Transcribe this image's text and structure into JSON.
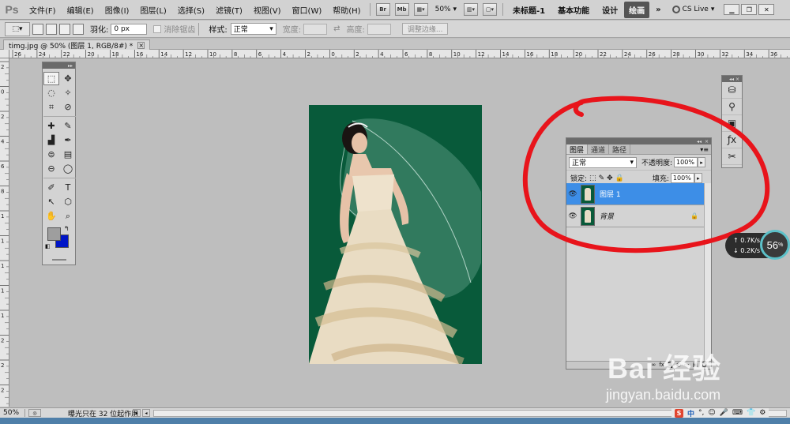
{
  "menubar": {
    "logo": "Ps",
    "items": [
      "文件(F)",
      "编辑(E)",
      "图像(I)",
      "图层(L)",
      "选择(S)",
      "滤镜(T)",
      "视图(V)",
      "窗口(W)",
      "帮助(H)"
    ],
    "btn_br": "Br",
    "btn_mb": "Mb",
    "zoom": "50%",
    "workspaces": [
      "未标题-1",
      "基本功能",
      "设计",
      "绘画"
    ],
    "more": "»",
    "cs_live": "CS Live",
    "cs_live_arrow": "▾"
  },
  "options": {
    "feather_label": "羽化:",
    "feather_value": "0 px",
    "antialias_label": "消除锯齿",
    "style_label": "样式:",
    "style_value": "正常",
    "width_label": "宽度:",
    "height_label": "高度:",
    "refine_edge": "调整边缘..."
  },
  "document": {
    "tab_title": "timg.jpg @ 50% (图层 1, RGB/8#) *",
    "close": "×"
  },
  "ruler": {
    "h_labels": [
      "26",
      "24",
      "22",
      "20",
      "18",
      "16",
      "14",
      "12",
      "10",
      "8",
      "6",
      "4",
      "2",
      "0",
      "2",
      "4",
      "6",
      "8",
      "10",
      "12",
      "14",
      "16",
      "18",
      "20",
      "22",
      "24",
      "26",
      "28",
      "30",
      "32",
      "34",
      "36"
    ],
    "v_labels": [
      "2",
      "0",
      "2",
      "4",
      "6",
      "8",
      "1",
      "1",
      "1",
      "1",
      "1",
      "2",
      "2",
      "2"
    ]
  },
  "tools": [
    "⬚",
    "✥",
    "◌",
    "✧",
    "⌗",
    "⊘",
    "✚",
    "✎",
    "▟",
    "✒",
    "⊜",
    "▤",
    "⊖",
    "◯",
    "✐",
    "T",
    "↖",
    "⬡",
    "✋",
    "⌕"
  ],
  "mini_panel": [
    "⛁",
    "⚲",
    "▣",
    "ƒx",
    "✂"
  ],
  "layers_panel": {
    "tabs": [
      "图层",
      "通道",
      "路径"
    ],
    "collapse": "◂◂",
    "close": "×",
    "menu": "▾≡",
    "blend_mode": "正常",
    "opacity_label": "不透明度:",
    "opacity_value": "100%",
    "lock_label": "锁定:",
    "fill_label": "填充:",
    "fill_value": "100%",
    "layers": [
      {
        "name": "图层 1",
        "selected": true
      },
      {
        "name": "背景",
        "selected": false,
        "locked": true
      }
    ]
  },
  "network": {
    "up": "0.7K/s",
    "down": "0.2K/s",
    "percent": "56",
    "percent_sign": "%"
  },
  "watermark": {
    "brand": "Bai 经验",
    "url": "jingyan.baidu.com"
  },
  "status": {
    "zoom": "50%",
    "message": "曝光只在 32 位起作用"
  },
  "ime": {
    "s": "S",
    "zh": "中",
    "icons": [
      "°,",
      "☺",
      "🎤",
      "⌨",
      "👕",
      "⚙"
    ]
  },
  "colors": {
    "annotation": "#e8141b",
    "canvas_bg": "#085a3a",
    "selection": "#3d8ee7",
    "fg": "#9e9e9e",
    "bg": "#0015c7"
  }
}
